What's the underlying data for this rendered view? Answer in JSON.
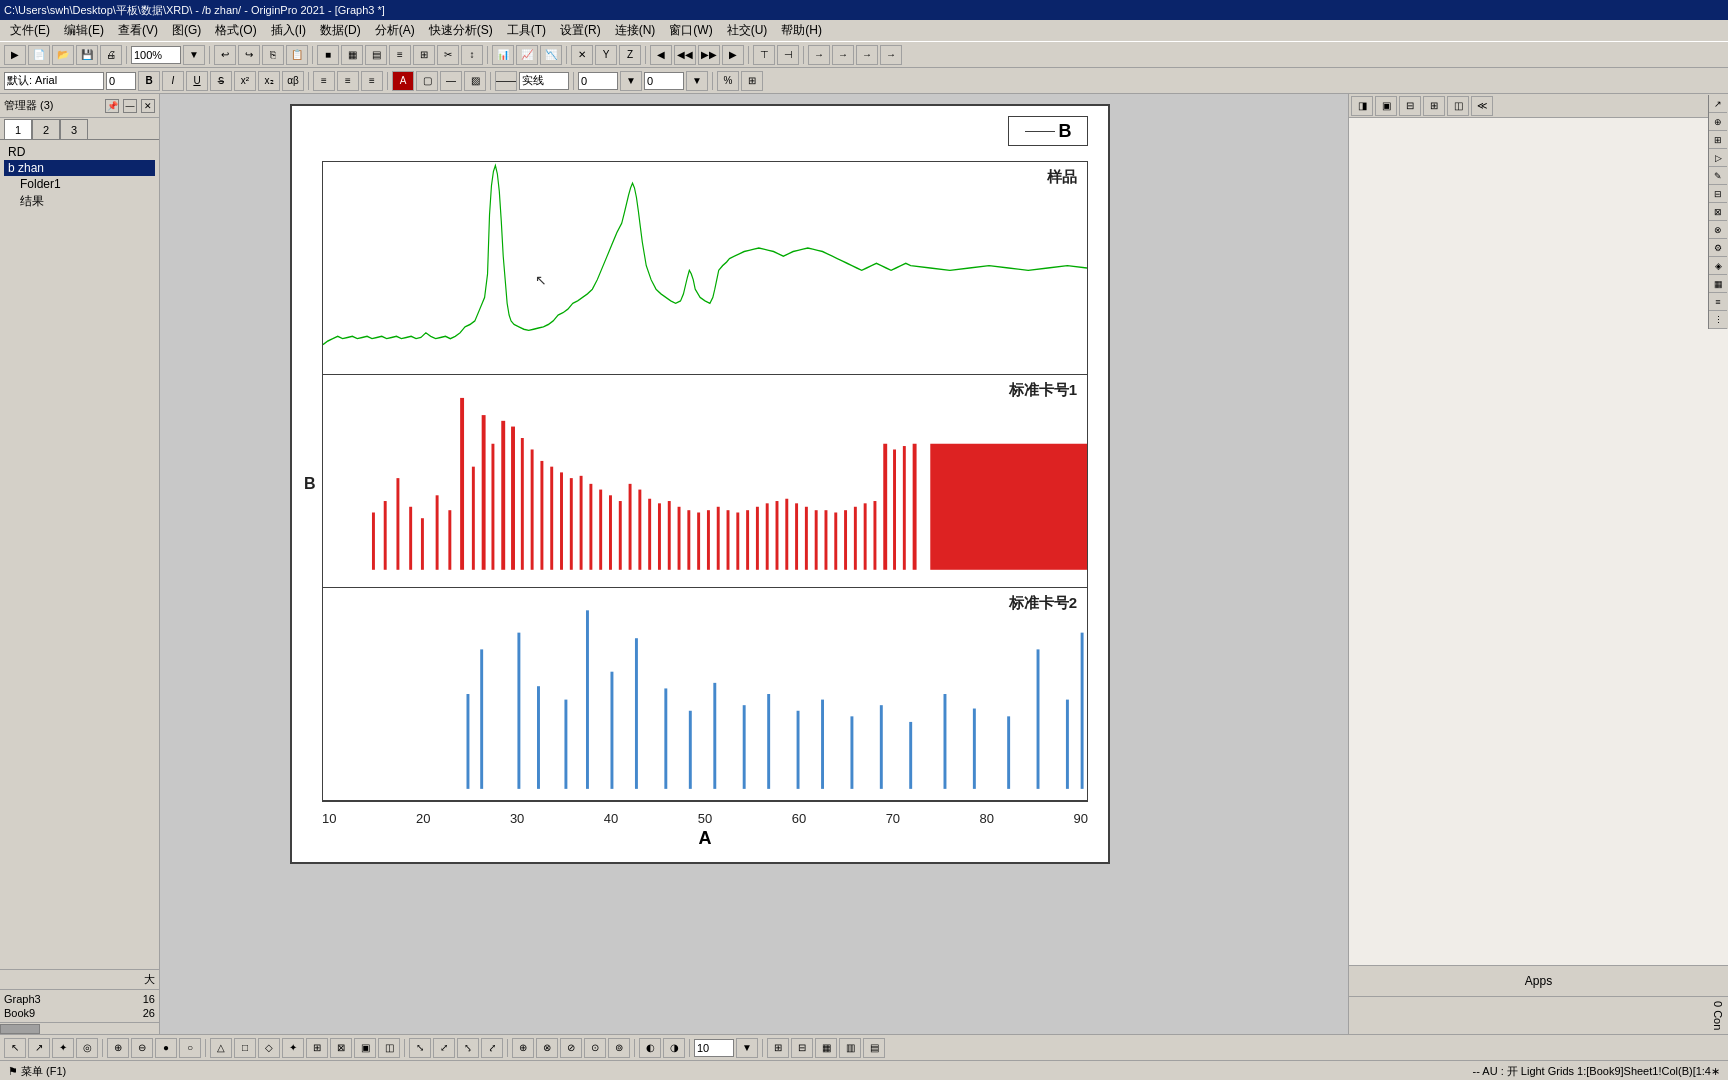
{
  "titlebar": {
    "text": "C:\\Users\\swh\\Desktop\\平板\\数据\\XRD\\ - /b zhan/ - OriginPro 2021 - [Graph3 *]"
  },
  "menubar": {
    "items": [
      "文件(E)",
      "编辑(E)",
      "查看(V)",
      "图(G)",
      "格式(O)",
      "插入(I)",
      "数据(D)",
      "分析(A)",
      "快速分析(S)",
      "工具(T)",
      "设置(R)",
      "连接(N)",
      "窗口(W)",
      "社交(U)",
      "帮助(H)"
    ]
  },
  "toolbar1": {
    "zoom": "100%"
  },
  "formatbar": {
    "font": "默认: Arial",
    "size": "0",
    "lineStyle": "实线",
    "val1": "0",
    "val2": "0"
  },
  "left_panel": {
    "title": "管理器 (3)",
    "items": [
      {
        "label": "RD",
        "indent": 0
      },
      {
        "label": "b zhan",
        "indent": 0,
        "selected": true
      },
      {
        "label": "Folder1",
        "indent": 1
      },
      {
        "label": "结果",
        "indent": 1
      }
    ],
    "col_header": "大",
    "stats": [
      {
        "name": "Graph3",
        "value": "16"
      },
      {
        "name": "Book9",
        "value": "26"
      }
    ]
  },
  "page_tabs": [
    "1",
    "2",
    "3"
  ],
  "graph": {
    "title": "Graph3",
    "legend_label": "B",
    "y_axis_label": "B",
    "x_axis_label": "A",
    "x_ticks": [
      "10",
      "20",
      "30",
      "40",
      "50",
      "60",
      "70",
      "80",
      "90"
    ],
    "panels": [
      {
        "label": "样品",
        "color": "#00aa00",
        "type": "spectrum"
      },
      {
        "label": "标准卡号1",
        "color": "#dd2222",
        "type": "bars"
      },
      {
        "label": "标准卡号2",
        "color": "#4488cc",
        "type": "lines"
      }
    ]
  },
  "status_bar": {
    "left": "⚑ 菜单 (F1)",
    "right": "-- AU : 开 Light Grids 1:[Book9]Sheet1!Col(B)[1:4∗"
  },
  "bottom_right": {
    "apps_label": "Apps",
    "con_label": "0 Con"
  },
  "toolbar_bottom": {
    "zoom_val": "10"
  }
}
